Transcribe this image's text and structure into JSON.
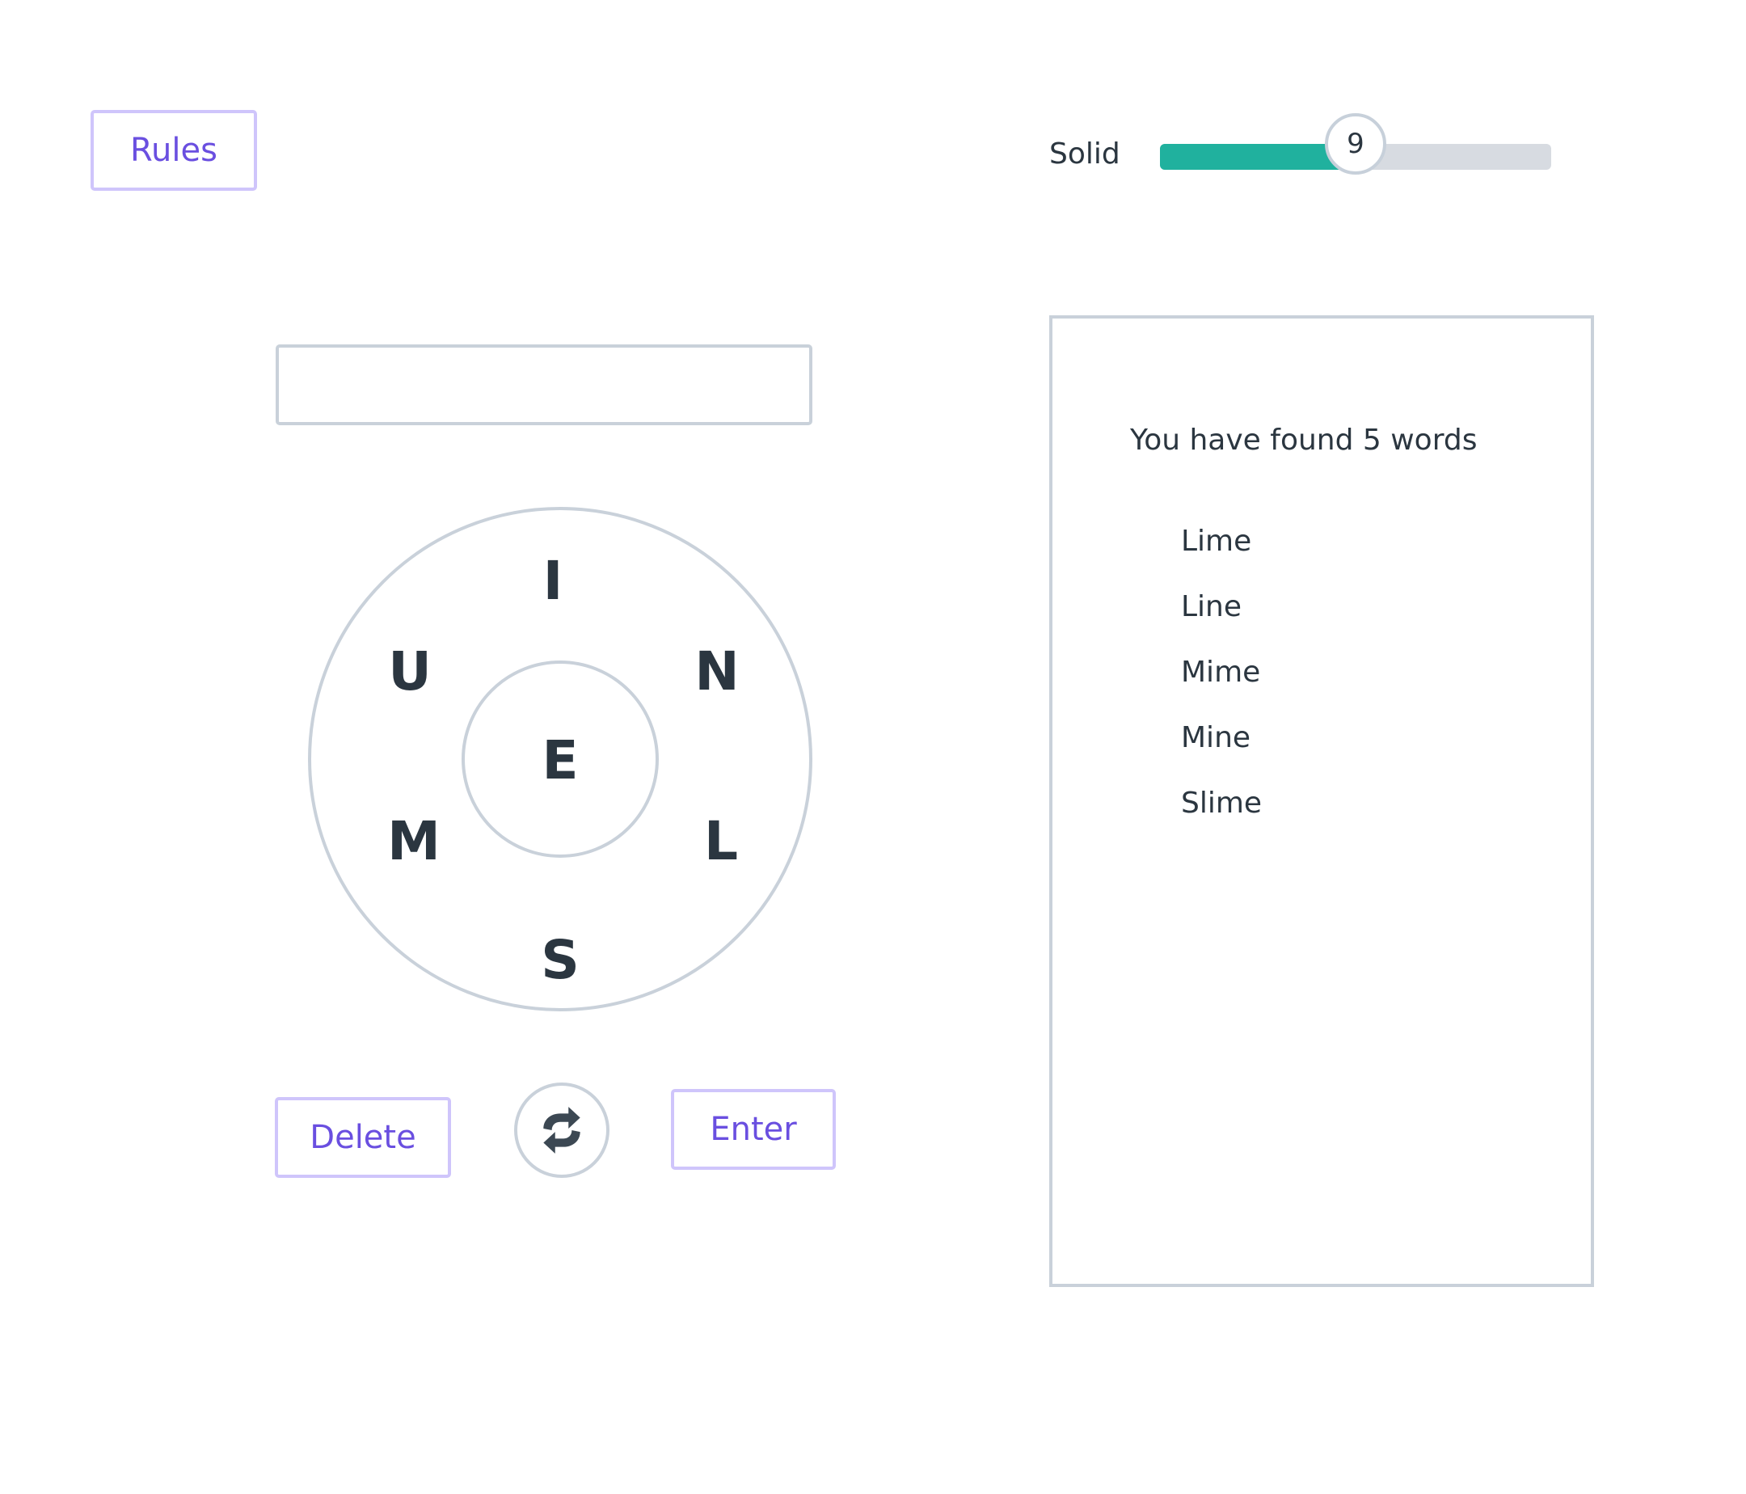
{
  "header": {
    "rules_label": "Rules"
  },
  "progress": {
    "rank_label": "Solid",
    "score": "9",
    "fill_fraction": 0.5
  },
  "input": {
    "value": "",
    "placeholder": ""
  },
  "wheel": {
    "center_letter": "E",
    "outer_letters": {
      "top": "I",
      "upper_left": "U",
      "upper_right": "N",
      "lower_left": "M",
      "lower_right": "L",
      "bottom": "S"
    }
  },
  "controls": {
    "delete_label": "Delete",
    "enter_label": "Enter",
    "shuffle_icon": "shuffle-icon"
  },
  "found": {
    "title": "You have found 5 words",
    "words": [
      "Lime",
      "Line",
      "Mime",
      "Mine",
      "Slime"
    ]
  },
  "colors": {
    "accent": "#6a4fe0",
    "accent_border": "#cfc5fb",
    "progress_fill": "#20b19e",
    "progress_track": "#d7dbe1",
    "border": "#c9d1da",
    "text": "#2b3640"
  }
}
